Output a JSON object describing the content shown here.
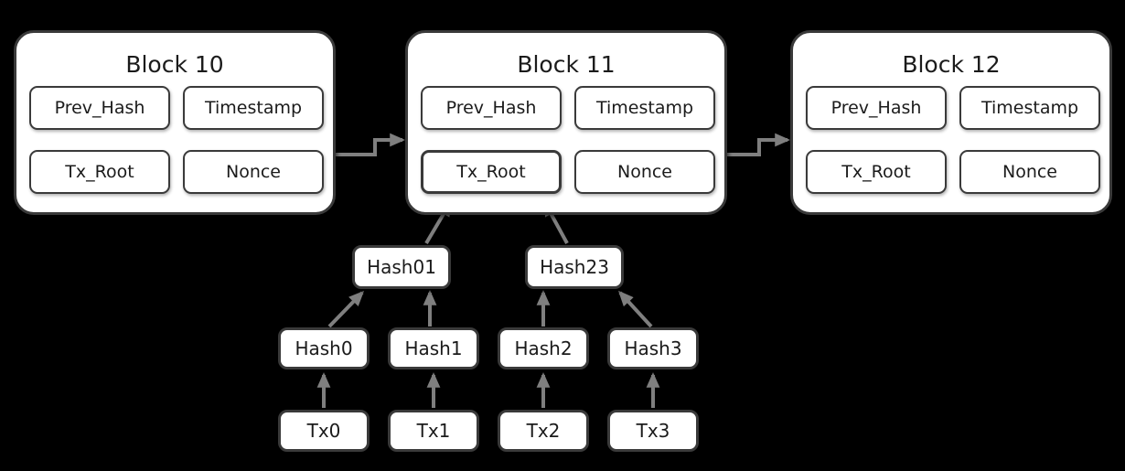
{
  "diagram": {
    "title_hidden": "Blockchain with Merkle tree",
    "background_color": "#000000",
    "box_fill": "#ffffff",
    "box_stroke": "#3a3a3a",
    "arrow_color": "#7f7f7f",
    "text_color": "#1b1b1b"
  },
  "blocks": [
    {
      "id": "block-10",
      "title": "Block 10",
      "fields": {
        "prev_hash": "Prev_Hash",
        "timestamp": "Timestamp",
        "tx_root": "Tx_Root",
        "nonce": "Nonce"
      }
    },
    {
      "id": "block-11",
      "title": "Block 11",
      "fields": {
        "prev_hash": "Prev_Hash",
        "timestamp": "Timestamp",
        "tx_root": "Tx_Root",
        "nonce": "Nonce"
      }
    },
    {
      "id": "block-12",
      "title": "Block 12",
      "fields": {
        "prev_hash": "Prev_Hash",
        "timestamp": "Timestamp",
        "tx_root": "Tx_Root",
        "nonce": "Nonce"
      }
    }
  ],
  "merkle": {
    "branch_nodes": [
      {
        "id": "hash01",
        "label": "Hash01"
      },
      {
        "id": "hash23",
        "label": "Hash23"
      }
    ],
    "leaf_hash_nodes": [
      {
        "id": "hash0",
        "label": "Hash0"
      },
      {
        "id": "hash1",
        "label": "Hash1"
      },
      {
        "id": "hash2",
        "label": "Hash2"
      },
      {
        "id": "hash3",
        "label": "Hash3"
      }
    ],
    "transaction_nodes": [
      {
        "id": "tx0",
        "label": "Tx0"
      },
      {
        "id": "tx1",
        "label": "Tx1"
      },
      {
        "id": "tx2",
        "label": "Tx2"
      },
      {
        "id": "tx3",
        "label": "Tx3"
      }
    ]
  },
  "connectors": [
    {
      "id": "block10-to-block11",
      "type": "elbow-arrow"
    },
    {
      "id": "block11-to-block12",
      "type": "elbow-arrow"
    },
    {
      "id": "hash01-to-txroot11",
      "type": "diagonal-arrow"
    },
    {
      "id": "hash23-to-txroot11",
      "type": "diagonal-arrow"
    },
    {
      "id": "hash0-to-hash01",
      "type": "diagonal-arrow"
    },
    {
      "id": "hash1-to-hash01",
      "type": "vertical-arrow"
    },
    {
      "id": "hash2-to-hash23",
      "type": "vertical-arrow"
    },
    {
      "id": "hash3-to-hash23",
      "type": "diagonal-arrow"
    },
    {
      "id": "tx0-to-hash0",
      "type": "vertical-arrow"
    },
    {
      "id": "tx1-to-hash1",
      "type": "vertical-arrow"
    },
    {
      "id": "tx2-to-hash2",
      "type": "vertical-arrow"
    },
    {
      "id": "tx3-to-hash3",
      "type": "vertical-arrow"
    }
  ]
}
